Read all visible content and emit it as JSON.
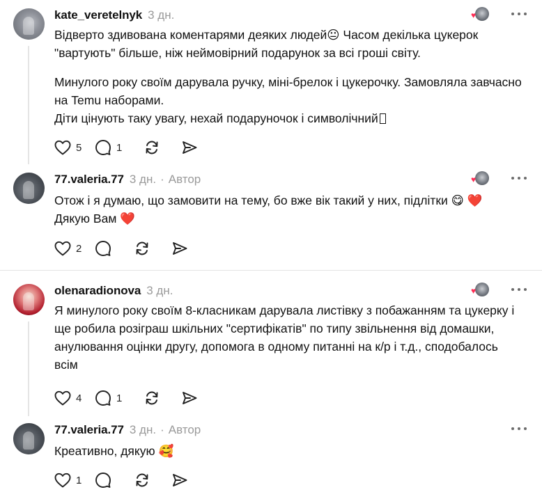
{
  "posts": [
    {
      "username": "kate_veretelnyk",
      "time": "3 дн.",
      "paragraphs": [
        "Відверто здивована коментарями деяких людей😐 Часом декілька цукерок \"вартують\" більше, ніж неймовірний подарунок за всі гроші світу.",
        "Минулого року своїм дарувала ручку, міні-брелок і цукерочку. Замовляла завчасно на Temu наборами.",
        "Діти цінують таку увагу, нехай подаруночок і символічний"
      ],
      "likes": "5",
      "replies": "1"
    },
    {
      "username": "77.valeria.77",
      "time": "3 дн.",
      "author_label": "Автор",
      "paragraphs": [
        "Отож і я думаю, що замовити на тему, бо вже вік такий у них, підлітки 😋 ❤️",
        "Дякую Вам ❤️"
      ],
      "likes": "2",
      "replies": ""
    },
    {
      "username": "olenaradionova",
      "time": "3 дн.",
      "paragraphs": [
        "Я минулого року своїм 8-класникам дарувала листівку з побажанням та цукерку і ще робила розіграш шкільних \"сертифікатів\" по типу звільнення від домашки, анулювання оцінки другу, допомога в одному питанні на к/р і т.д., сподобалось всім"
      ],
      "likes": "4",
      "replies": "1"
    },
    {
      "username": "77.valeria.77",
      "time": "3 дн.",
      "author_label": "Автор",
      "paragraphs": [
        "Креативно, дякую 🥰"
      ],
      "likes": "1",
      "replies": ""
    }
  ],
  "icons": {
    "like": "heart-icon",
    "reply": "comment-bubble-icon",
    "repost": "repost-icon",
    "share": "send-icon",
    "more": "more-dots-icon"
  },
  "colors": {
    "text": "#111111",
    "muted": "#9a9a9a",
    "divider": "#e3e3e3",
    "heart_badge": "#ff2d55"
  }
}
